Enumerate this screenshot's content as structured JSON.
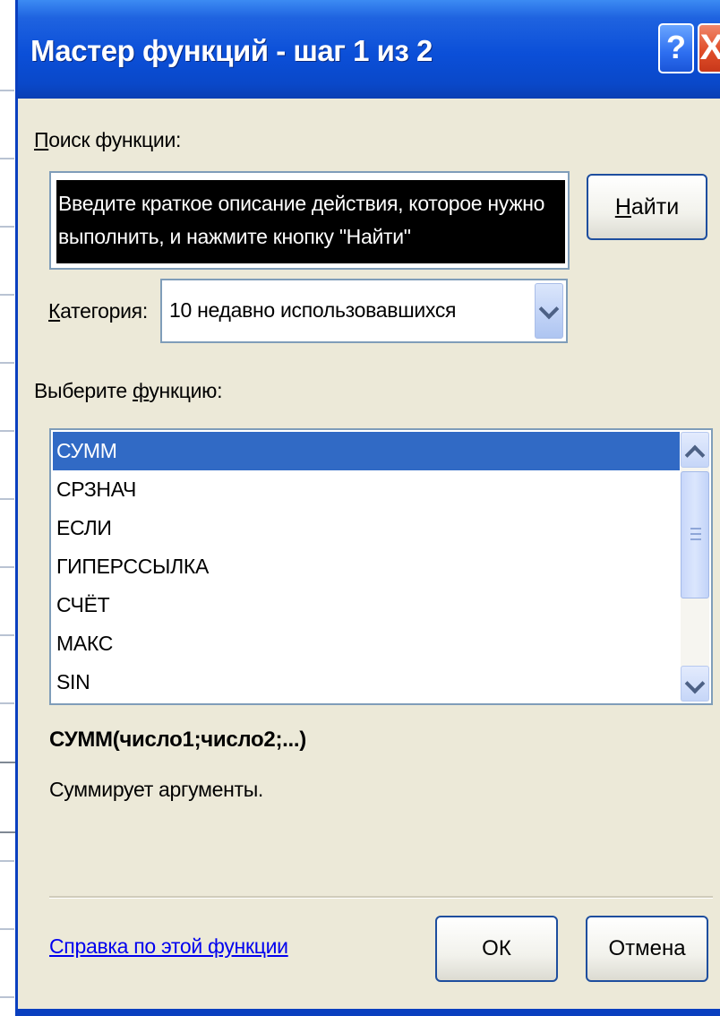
{
  "dialog": {
    "title": "Мастер функций - шаг 1 из 2",
    "help_button": "?",
    "close_button": "X"
  },
  "search": {
    "label_first": "П",
    "label_rest": "оиск функции:",
    "text": "Введите краткое описание действия, которое нужно выполнить, и нажмите кнопку \"Найти\"",
    "find_button_first": "Н",
    "find_button_rest": "айти"
  },
  "category": {
    "label_first": "К",
    "label_rest": "атегория:",
    "value": "10 недавно использовавшихся"
  },
  "function_list": {
    "label_before": "Выберите ",
    "label_underlined": "ф",
    "label_after": "ункцию:",
    "items": [
      "СУММ",
      "СРЗНАЧ",
      "ЕСЛИ",
      "ГИПЕРССЫЛКА",
      "СЧЁТ",
      "МАКС",
      "SIN"
    ],
    "selected_index": 0
  },
  "selected_function": {
    "signature": "СУММ(число1;число2;...)",
    "description": "Суммирует аргументы."
  },
  "footer": {
    "help_link": "Справка по этой функции",
    "ok_button": "ОК",
    "cancel_button": "Отмена"
  },
  "colors": {
    "title_bar": "#0a48c9",
    "selection": "#316ac5",
    "dialog_bg": "#ece9d8",
    "link": "#0000ee"
  }
}
